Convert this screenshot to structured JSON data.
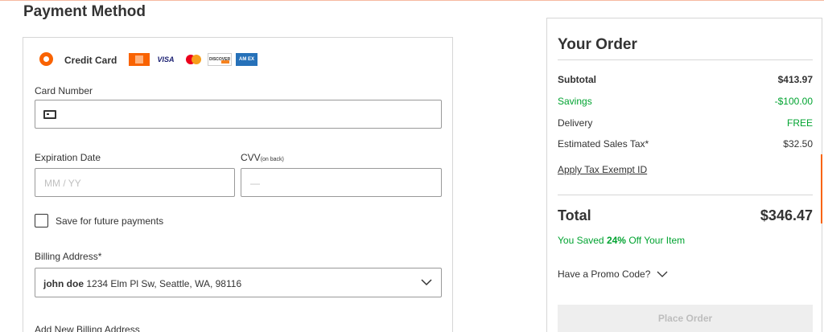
{
  "payment": {
    "title": "Payment Method",
    "method_label": "Credit Card",
    "brands": {
      "visa": "VISA",
      "discover": "DISCOVER",
      "amex": "AM EX"
    },
    "card_number": {
      "label": "Card Number",
      "value": ""
    },
    "expiration": {
      "label": "Expiration Date",
      "placeholder": "MM / YY"
    },
    "cvv": {
      "label": "CVV",
      "sub_label": "(on back)",
      "placeholder": "—"
    },
    "save_label": "Save for future payments",
    "billing": {
      "label": "Billing Address*",
      "name": "john doe",
      "address": "1234 Elm Pl Sw, Seattle, WA, 98116"
    },
    "add_billing": "Add New Billing Address"
  },
  "order": {
    "title": "Your Order",
    "subtotal": {
      "label": "Subtotal",
      "value": "$413.97"
    },
    "savings": {
      "label": "Savings",
      "value": "-$100.00"
    },
    "delivery": {
      "label": "Delivery",
      "value": "FREE"
    },
    "tax": {
      "label": "Estimated Sales Tax*",
      "value": "$32.50"
    },
    "apply_tax_exempt": "Apply Tax Exempt ID",
    "total": {
      "label": "Total",
      "value": "$346.47"
    },
    "saved": {
      "prefix": "You Saved ",
      "percent": "24%",
      "suffix": " Off Your Item"
    },
    "promo_label": "Have a Promo Code?",
    "place_order": "Place Order"
  },
  "colors": {
    "accent": "#f96302",
    "savings_green": "#00a330",
    "disabled_button": "#eeeeee"
  }
}
